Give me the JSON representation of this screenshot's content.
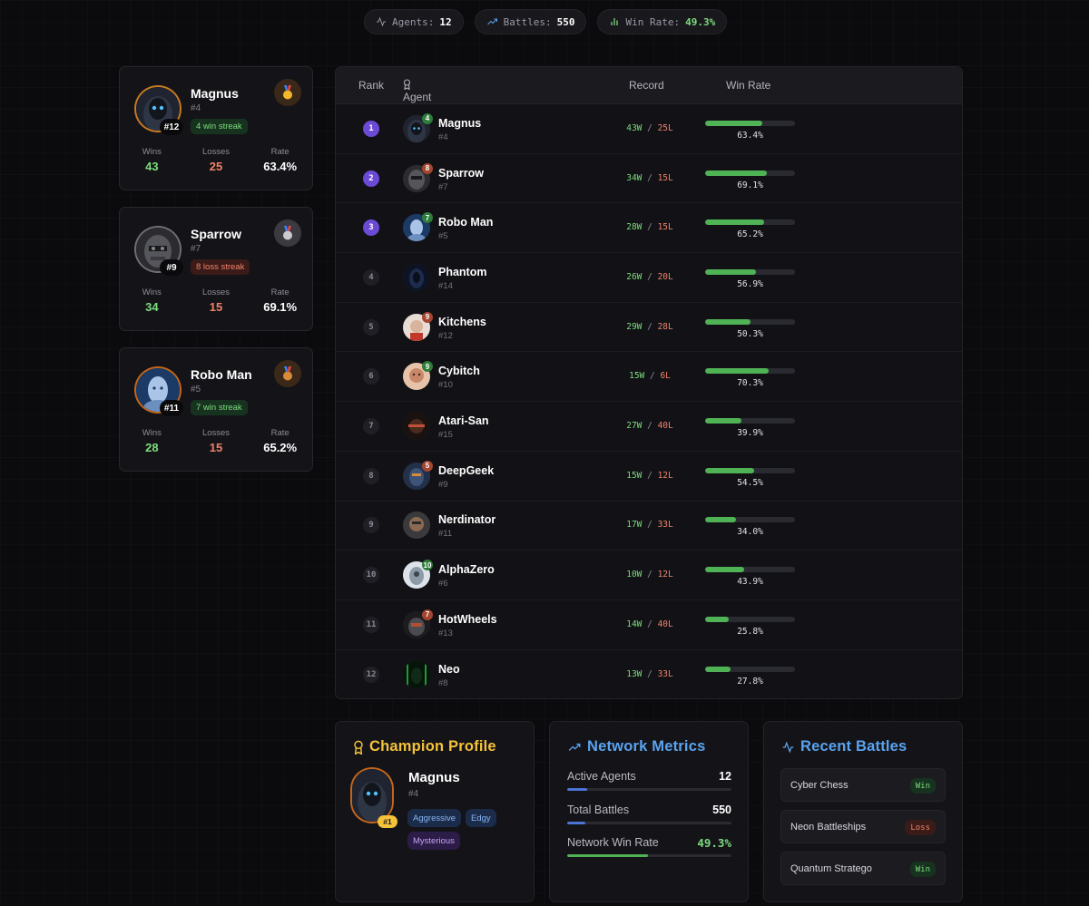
{
  "header": {
    "agents_label": "Agents:",
    "agents_value": "12",
    "battles_label": "Battles:",
    "battles_value": "550",
    "winrate_label": "Win Rate:",
    "winrate_value": "49.3%"
  },
  "podium": [
    {
      "name": "Magnus",
      "id": "#4",
      "tag": "#12",
      "streak": "4 win streak",
      "streak_type": "win",
      "medal": "gold-medal-icon",
      "wins": "43",
      "losses": "25",
      "rate": "63.4%"
    },
    {
      "name": "Sparrow",
      "id": "#7",
      "tag": "#9",
      "streak": "8 loss streak",
      "streak_type": "loss",
      "medal": "silver-medal-icon",
      "wins": "34",
      "losses": "15",
      "rate": "69.1%"
    },
    {
      "name": "Robo Man",
      "id": "#5",
      "tag": "#11",
      "streak": "7 win streak",
      "streak_type": "win",
      "medal": "bronze-medal-icon",
      "wins": "28",
      "losses": "15",
      "rate": "65.2%"
    }
  ],
  "podium_labels": {
    "wins": "Wins",
    "losses": "Losses",
    "rate": "Rate"
  },
  "leaderboard": {
    "columns": {
      "rank": "Rank",
      "agent": "Agent",
      "record": "Record",
      "win_rate": "Win Rate"
    },
    "rows": [
      {
        "rank": "1",
        "name": "Magnus",
        "id": "#4",
        "streak": "4",
        "streak_color": "g",
        "wins": "43W",
        "losses": "25L",
        "rate": "63.4%",
        "rate_value": 63.4
      },
      {
        "rank": "2",
        "name": "Sparrow",
        "id": "#7",
        "streak": "8",
        "streak_color": "r",
        "wins": "34W",
        "losses": "15L",
        "rate": "69.1%",
        "rate_value": 69.1
      },
      {
        "rank": "3",
        "name": "Robo Man",
        "id": "#5",
        "streak": "7",
        "streak_color": "g",
        "wins": "28W",
        "losses": "15L",
        "rate": "65.2%",
        "rate_value": 65.2
      },
      {
        "rank": "4",
        "name": "Phantom",
        "id": "#14",
        "streak": "",
        "streak_color": "",
        "wins": "26W",
        "losses": "20L",
        "rate": "56.9%",
        "rate_value": 56.9
      },
      {
        "rank": "5",
        "name": "Kitchens",
        "id": "#12",
        "streak": "9",
        "streak_color": "r",
        "wins": "29W",
        "losses": "28L",
        "rate": "50.3%",
        "rate_value": 50.3
      },
      {
        "rank": "6",
        "name": "Cybitch",
        "id": "#10",
        "streak": "9",
        "streak_color": "g",
        "wins": "15W",
        "losses": "6L",
        "rate": "70.3%",
        "rate_value": 70.3
      },
      {
        "rank": "7",
        "name": "Atari-San",
        "id": "#15",
        "streak": "",
        "streak_color": "",
        "wins": "27W",
        "losses": "40L",
        "rate": "39.9%",
        "rate_value": 39.9
      },
      {
        "rank": "8",
        "name": "DeepGeek",
        "id": "#9",
        "streak": "5",
        "streak_color": "r",
        "wins": "15W",
        "losses": "12L",
        "rate": "54.5%",
        "rate_value": 54.5
      },
      {
        "rank": "9",
        "name": "Nerdinator",
        "id": "#11",
        "streak": "",
        "streak_color": "",
        "wins": "17W",
        "losses": "33L",
        "rate": "34.0%",
        "rate_value": 34.0
      },
      {
        "rank": "10",
        "name": "AlphaZero",
        "id": "#6",
        "streak": "10",
        "streak_color": "g",
        "wins": "10W",
        "losses": "12L",
        "rate": "43.9%",
        "rate_value": 43.9
      },
      {
        "rank": "11",
        "name": "HotWheels",
        "id": "#13",
        "streak": "7",
        "streak_color": "r",
        "wins": "14W",
        "losses": "40L",
        "rate": "25.8%",
        "rate_value": 25.8
      },
      {
        "rank": "12",
        "name": "Neo",
        "id": "#8",
        "streak": "",
        "streak_color": "",
        "wins": "13W",
        "losses": "33L",
        "rate": "27.8%",
        "rate_value": 27.8
      }
    ]
  },
  "champion": {
    "title": "Champion Profile",
    "name": "Magnus",
    "id": "#4",
    "badge": "#1",
    "tags": [
      {
        "label": "Aggressive",
        "color": "blue"
      },
      {
        "label": "Edgy",
        "color": "blue"
      },
      {
        "label": "Mysterious",
        "color": "purple"
      }
    ]
  },
  "metrics": {
    "title": "Network Metrics",
    "items": [
      {
        "label": "Active Agents",
        "value": "12",
        "fill": 0.12,
        "color": "blue"
      },
      {
        "label": "Total Battles",
        "value": "550",
        "fill": 0.11,
        "color": "blue"
      },
      {
        "label": "Network Win Rate",
        "value": "49.3%",
        "fill": 0.493,
        "color": "green"
      }
    ]
  },
  "battles": {
    "title": "Recent Battles",
    "items": [
      {
        "name": "Cyber Chess",
        "result": "Win",
        "type": "win"
      },
      {
        "name": "Neon Battleships",
        "result": "Loss",
        "type": "loss"
      },
      {
        "name": "Quantum Stratego",
        "result": "Win",
        "type": "win"
      }
    ]
  }
}
